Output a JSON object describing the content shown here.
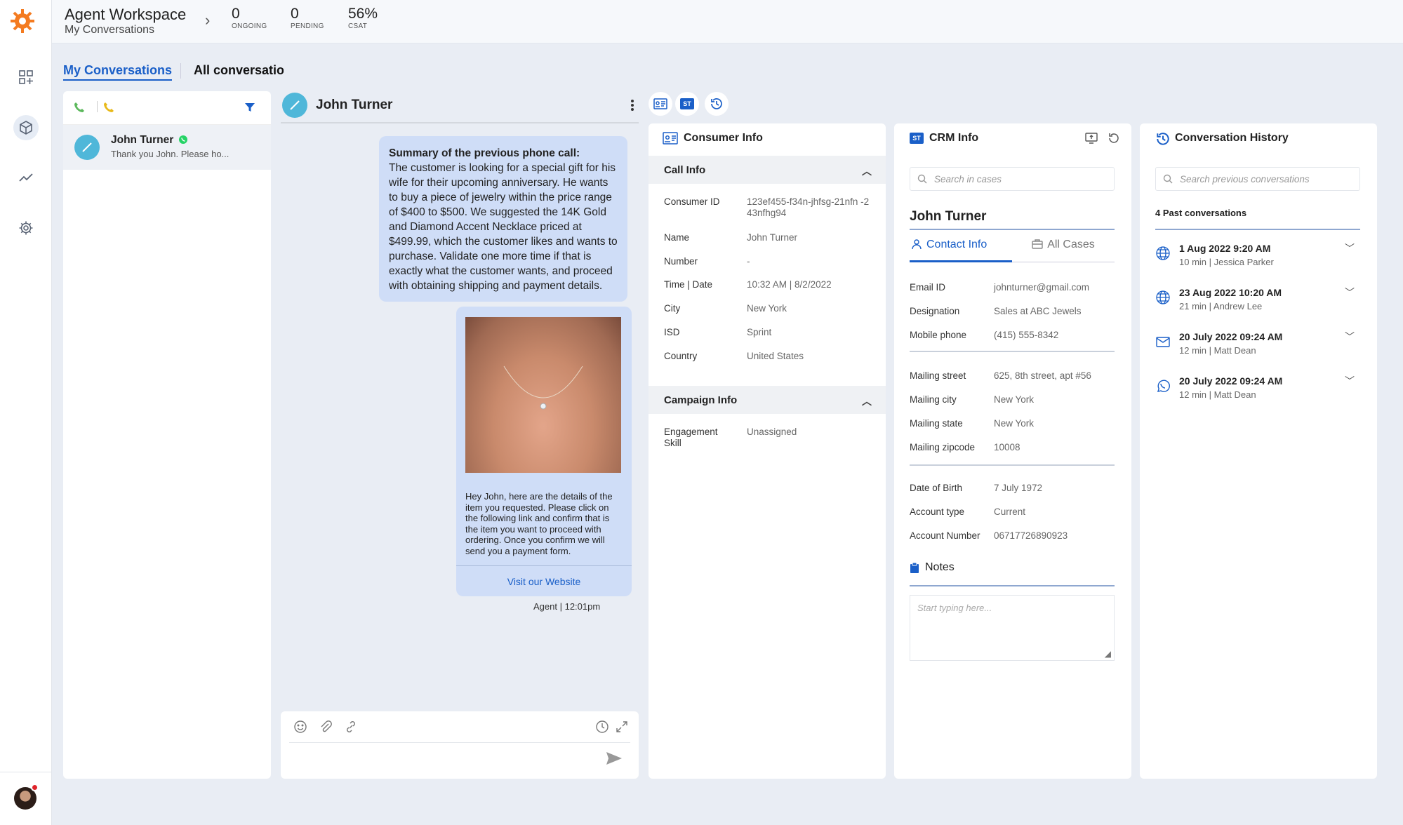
{
  "header": {
    "title": "Agent Workspace",
    "subtitle": "My Conversations",
    "stats": [
      {
        "value": "0",
        "label": "ONGOING"
      },
      {
        "value": "0",
        "label": "PENDING"
      },
      {
        "value": "56%",
        "label": "CSAT"
      }
    ]
  },
  "tabs": {
    "my": "My Conversations",
    "all": "All conversations"
  },
  "conversation_list": {
    "items": [
      {
        "name": "John Turner",
        "preview": "Thank you John. Please ho..."
      }
    ]
  },
  "chat": {
    "contact_name": "John Turner",
    "summary_title": "Summary of the previous phone call:",
    "summary_text": "The customer is looking for a special gift for his wife for their upcoming anniversary. He wants to buy a piece of jewelry within the price range of $400 to $500. We suggested the 14K Gold and Diamond Accent Necklace priced at $499.99, which the customer likes and wants to purchase. Validate one more time if that is exactly what the customer wants, and proceed with obtaining shipping and payment details.",
    "card_text": "Hey John, here are the details of the item you requested. Please click on the following link and confirm that is the item you want to proceed with ordering. Once you confirm we will send you a payment form.",
    "card_link": "Visit our Website",
    "sender": "Agent |",
    "time": "12:01pm"
  },
  "consumer_info": {
    "title": "Consumer Info",
    "call_info_title": "Call Info",
    "fields": [
      {
        "label": "Consumer ID",
        "value": "123ef455-f34n-jhfsg-21nfn -243nfhg94"
      },
      {
        "label": "Name",
        "value": "John Turner"
      },
      {
        "label": "Number",
        "value": "-"
      },
      {
        "label": "Time | Date",
        "value": "10:32 AM | 8/2/2022"
      },
      {
        "label": "City",
        "value": "New York"
      },
      {
        "label": "ISD",
        "value": "Sprint"
      },
      {
        "label": "Country",
        "value": "United States"
      }
    ],
    "campaign_title": "Campaign Info",
    "campaign_fields": [
      {
        "label": "Engagement Skill",
        "value": "Unassigned"
      }
    ]
  },
  "crm": {
    "title": "CRM Info",
    "badge": "ST",
    "search_placeholder": "Search in cases",
    "name": "John Turner",
    "tab_contact": "Contact Info",
    "tab_cases": "All Cases",
    "group1": [
      {
        "label": "Email ID",
        "value": "johnturner@gmail.com"
      },
      {
        "label": "Designation",
        "value": "Sales at ABC Jewels"
      },
      {
        "label": "Mobile phone",
        "value": "(415) 555-8342"
      }
    ],
    "group2": [
      {
        "label": "Mailing street",
        "value": "625, 8th street, apt #56"
      },
      {
        "label": "Mailing city",
        "value": "New York"
      },
      {
        "label": "Mailing state",
        "value": "New York"
      },
      {
        "label": "Mailing zipcode",
        "value": "10008"
      }
    ],
    "group3": [
      {
        "label": "Date of Birth",
        "value": "7 July 1972"
      },
      {
        "label": "Account type",
        "value": "Current"
      },
      {
        "label": "Account Number",
        "value": "06717726890923"
      }
    ],
    "notes_title": "Notes",
    "notes_placeholder": "Start typing here..."
  },
  "history": {
    "title": "Conversation History",
    "search_placeholder": "Search previous conversations",
    "count_label": "4 Past conversations",
    "items": [
      {
        "date": "1 Aug 2022 9:20 AM",
        "sub": "10 min | Jessica Parker",
        "channel": "globe-icon"
      },
      {
        "date": "23 Aug 2022 10:20 AM",
        "sub": "21 min | Andrew Lee",
        "channel": "globe-icon"
      },
      {
        "date": "20 July 2022 09:24 AM",
        "sub": "12 min | Matt Dean",
        "channel": "mail-icon"
      },
      {
        "date": "20 July 2022 09:24 AM",
        "sub": "12 min | Matt Dean",
        "channel": "whatsapp-icon"
      }
    ]
  },
  "colors": {
    "accent": "#1a5fc8",
    "brand": "#f47b20",
    "bubble": "#cfddf7",
    "online": "#25d366"
  }
}
